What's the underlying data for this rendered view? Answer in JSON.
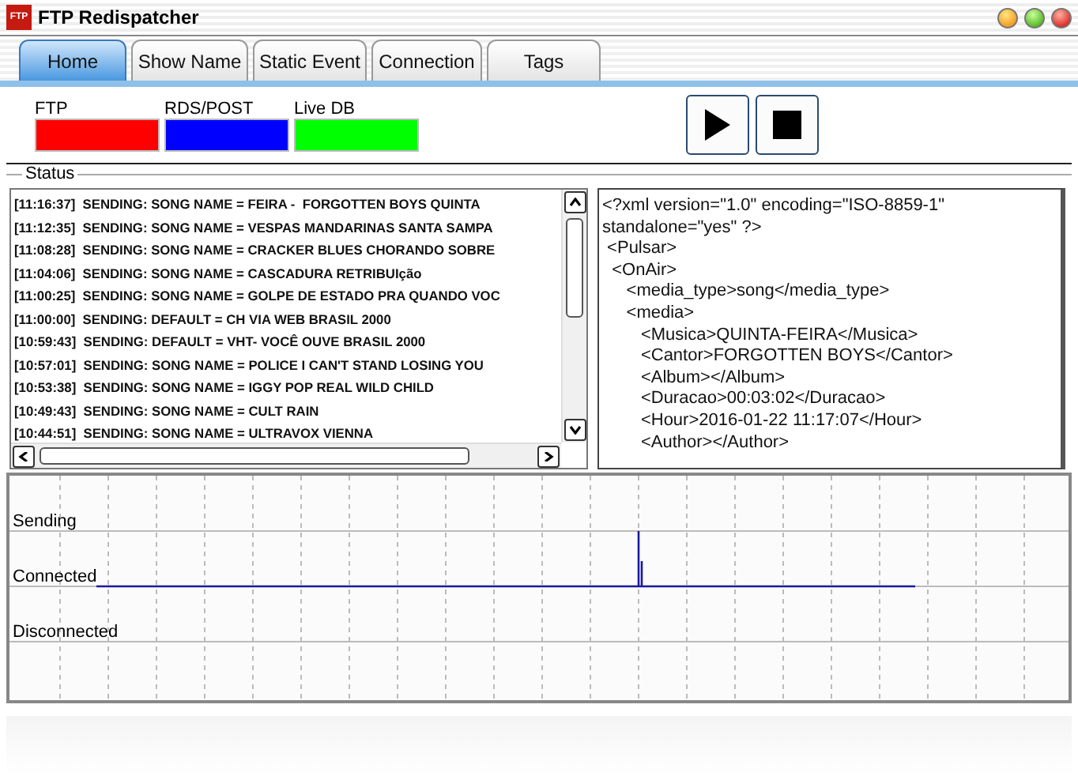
{
  "window": {
    "title": "FTP Redispatcher",
    "logo": "FTP"
  },
  "tabs": [
    {
      "label": "Home",
      "selected": true
    },
    {
      "label": "Show Name",
      "selected": false
    },
    {
      "label": "Static Event",
      "selected": false
    },
    {
      "label": "Connection",
      "selected": false
    },
    {
      "label": "Tags",
      "selected": false
    }
  ],
  "indicators": [
    {
      "label": "FTP",
      "color": "#ff0000"
    },
    {
      "label": "RDS/POST",
      "color": "#0000ff"
    },
    {
      "label": "Live DB",
      "color": "#00ff00"
    }
  ],
  "status": {
    "title": "Status",
    "log": [
      "[11:16:37]  SENDING: SONG NAME = FEIRA -  FORGOTTEN BOYS QUINTA",
      "[11:12:35]  SENDING: SONG NAME = VESPAS MANDARINAS SANTA SAMPA",
      "[11:08:28]  SENDING: SONG NAME = CRACKER BLUES CHORANDO SOBRE",
      "[11:04:06]  SENDING: SONG NAME = CASCADURA RETRIBUIção",
      "[11:00:25]  SENDING: SONG NAME = GOLPE DE ESTADO PRA QUANDO VOC",
      "[11:00:00]  SENDING: DEFAULT = CH VIA WEB BRASIL 2000",
      "[10:59:43]  SENDING: DEFAULT = VHT- VOCÊ OUVE BRASIL 2000",
      "[10:57:01]  SENDING: SONG NAME = POLICE I CAN'T STAND LOSING YOU",
      "[10:53:38]  SENDING: SONG NAME = IGGY POP REAL WILD CHILD",
      "[10:49:43]  SENDING: SONG NAME = CULT RAIN",
      "[10:44:51]  SENDING: SONG NAME = ULTRAVOX VIENNA"
    ],
    "xml": [
      "<?xml version=\"1.0\" encoding=\"ISO-8859-1\"",
      "standalone=\"yes\" ?>",
      " <Pulsar>",
      "  <OnAir>",
      "     <media_type>song</media_type>",
      "     <media>",
      "        <Musica>QUINTA-FEIRA</Musica>",
      "        <Cantor>FORGOTTEN BOYS</Cantor>",
      "        <Album></Album>",
      "        <Duracao>00:03:02</Duracao>",
      "        <Hour>2016-01-22 11:17:07</Hour>",
      "        <Author></Author>"
    ]
  },
  "graph": {
    "levels": [
      "Sending",
      "Connected",
      "Disconnected"
    ]
  }
}
